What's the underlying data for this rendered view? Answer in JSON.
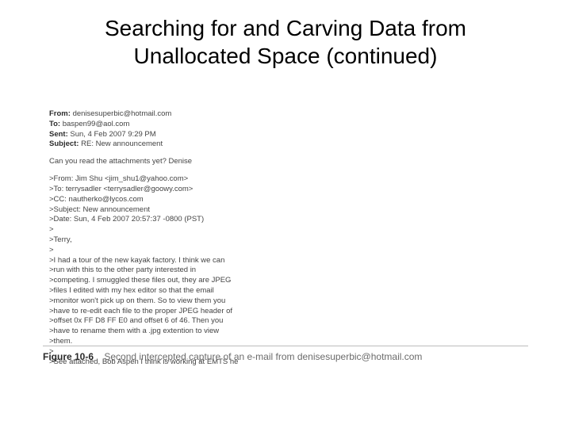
{
  "slide": {
    "title": "Searching for and Carving Data from Unallocated Space (continued)"
  },
  "email": {
    "headers": {
      "from_label": "From:",
      "from_value": "denisesuperbic@hotmail.com",
      "to_label": "To:",
      "to_value": "baspen99@aol.com",
      "sent_label": "Sent:",
      "sent_value": "Sun, 4 Feb 2007 9:29 PM",
      "subject_label": "Subject:",
      "subject_value": "RE: New announcement"
    },
    "body": {
      "l0": "Can you read the attachments yet? Denise",
      "l1": ">From: Jim Shu <jim_shu1@yahoo.com>",
      "l2": ">To: terrysadler <terrysadler@goowy.com>",
      "l3": ">CC: nautherko@lycos.com",
      "l4": ">Subject: New announcement",
      "l5": ">Date: Sun, 4 Feb 2007 20:57:37 -0800 (PST)",
      "l6": ">",
      "l7": ">Terry,",
      "l8": ">",
      "l9": ">I had a tour of the new kayak factory. I think we can",
      "l10": ">run with this to the other party interested in",
      "l11": ">competing. I smuggled these files out, they are JPEG",
      "l12": ">files I edited with my hex editor so that the email",
      "l13": ">monitor won't pick up on them. So to view them you",
      "l14": ">have to re-edit each file to the proper JPEG header of",
      "l15": ">offset 0x FF D8 FF E0 and offset 6 of 46. Then you",
      "l16": ">have to rename them with a .jpg extention to view",
      "l17": ">them.",
      "l18": ">",
      "l19": ">See attached, Bob Aspen I think is working at EMTS he"
    }
  },
  "figure": {
    "label": "Figure 10-6",
    "caption": "Second intercepted capture of an e-mail from denisesuperbic@hotmail.com"
  }
}
